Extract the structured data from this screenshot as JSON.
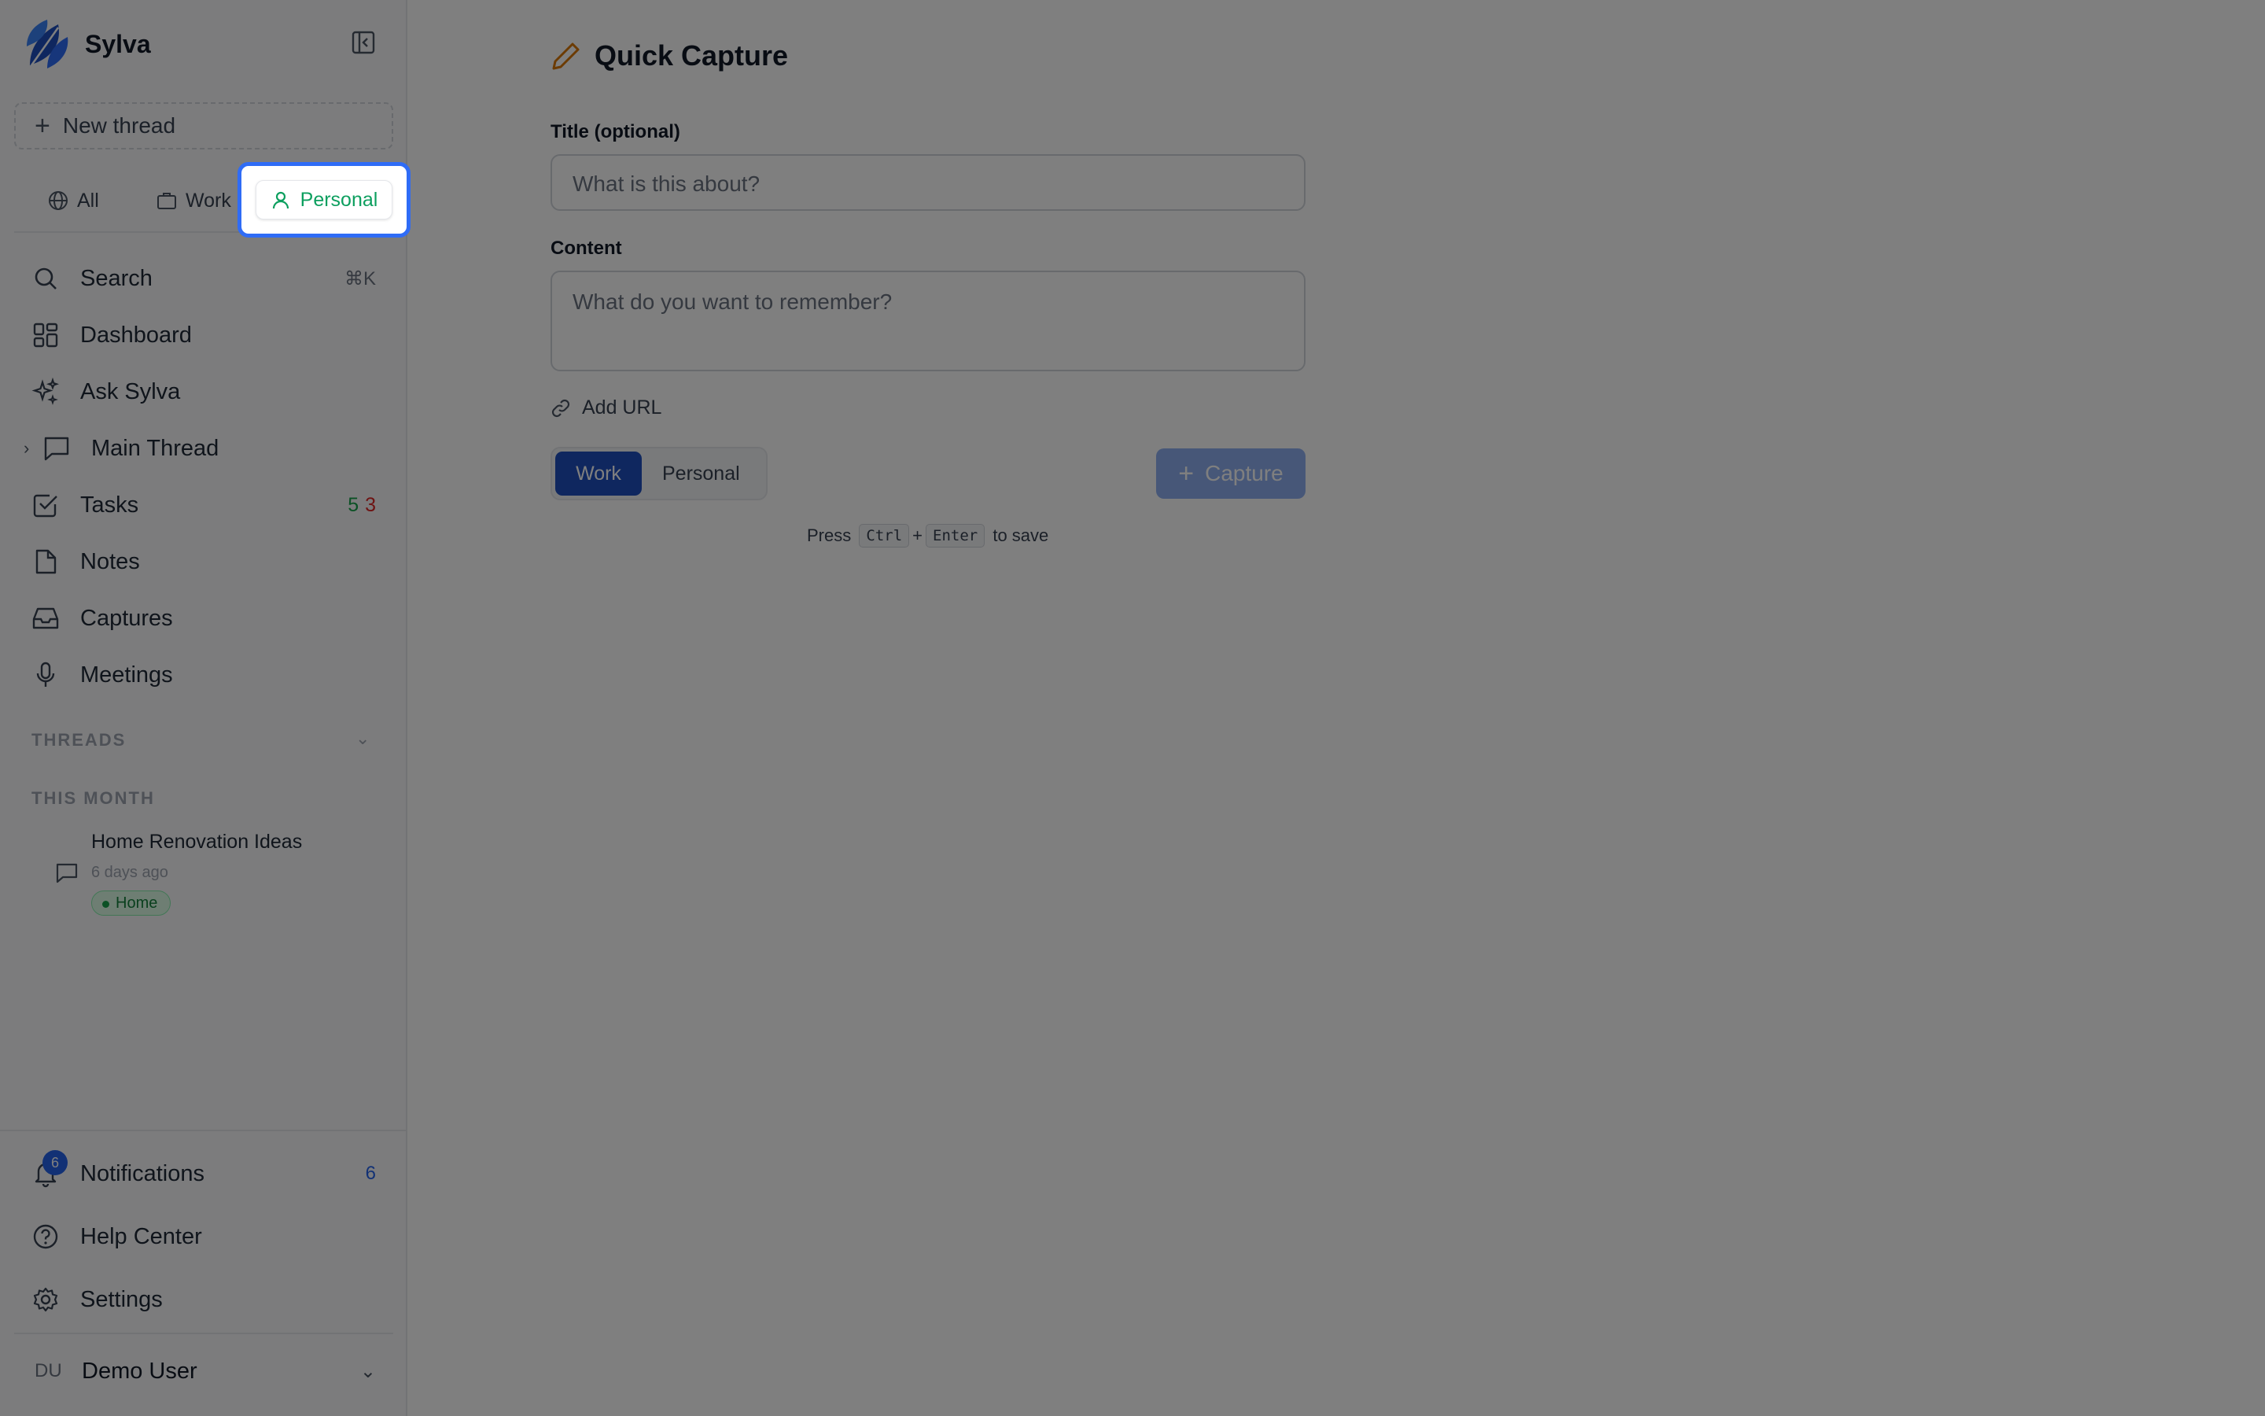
{
  "app": {
    "name": "Sylva"
  },
  "sidebar": {
    "new_thread_label": "New thread",
    "filters": {
      "all": "All",
      "work": "Work",
      "personal": "Personal"
    },
    "nav": {
      "search": {
        "label": "Search",
        "shortcut": "⌘K"
      },
      "dashboard": {
        "label": "Dashboard"
      },
      "ask": {
        "label": "Ask Sylva"
      },
      "main_thread": {
        "label": "Main Thread"
      },
      "tasks": {
        "label": "Tasks",
        "count_green": "5",
        "count_red": "3"
      },
      "notes": {
        "label": "Notes"
      },
      "captures": {
        "label": "Captures"
      },
      "meetings": {
        "label": "Meetings"
      }
    },
    "threads_section": "THREADS",
    "month_section": "THIS MONTH",
    "thread": {
      "title": "Home Renovation Ideas",
      "time": "6 days ago",
      "tag": "Home"
    },
    "bottom": {
      "notifications": {
        "label": "Notifications",
        "badge": "6",
        "count": "6"
      },
      "help": {
        "label": "Help Center"
      },
      "settings": {
        "label": "Settings"
      }
    },
    "user": {
      "initials": "DU",
      "name": "Demo User"
    }
  },
  "capture": {
    "heading": "Quick Capture",
    "title_label": "Title (optional)",
    "title_placeholder": "What is this about?",
    "content_label": "Content",
    "content_placeholder": "What do you want to remember?",
    "add_url": "Add URL",
    "segment": {
      "work": "Work",
      "personal": "Personal",
      "selected": "Work"
    },
    "button": "Capture",
    "hint": {
      "press": "Press",
      "key1": "Ctrl",
      "plus": "+",
      "key2": "Enter",
      "suffix": "to save"
    }
  },
  "colors": {
    "accent": "#2563eb",
    "personal_green": "#0d9f5f",
    "highlight": "#2f6cf6",
    "pencil": "#d97706"
  }
}
